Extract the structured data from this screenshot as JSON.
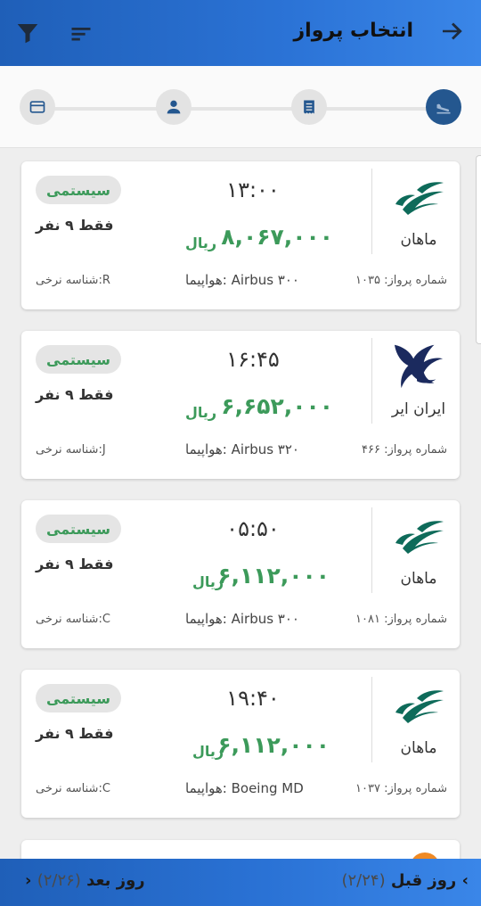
{
  "header": {
    "title": "انتخاب پرواز"
  },
  "icons": {
    "back": "arrow-right-icon",
    "filter": "filter-icon",
    "sort": "sort-icon"
  },
  "stepper": {
    "steps": [
      "flight-step",
      "invoice-step",
      "passenger-step",
      "payment-step"
    ],
    "active_index": 0,
    "colors": {
      "active": "#24578f",
      "inactive": "#e3e3e3"
    }
  },
  "flights": [
    {
      "airline": "ماهان",
      "time": "۱۳:۰۰",
      "price": "۸,۰۶۷,۰۰۰",
      "currency": "ریال",
      "badge": "سیستمی",
      "seats": "فقط ۹ نفر",
      "flight_no": "شماره پرواز: ۱۰۳۵",
      "aircraft": "هواپیما: Airbus ۳۰۰",
      "fare": "شناسه نرخی:R"
    },
    {
      "airline": "ایران ایر",
      "time": "۱۶:۴۵",
      "price": "۶,۶۵۲,۰۰۰",
      "currency": "ریال",
      "badge": "سیستمی",
      "seats": "فقط ۹ نفر",
      "flight_no": "شماره پرواز: ۴۶۶",
      "aircraft": "هواپیما: Airbus ۳۲۰",
      "fare": "شناسه نرخی:J"
    },
    {
      "airline": "ماهان",
      "time": "۰۵:۵۰",
      "price": "۶,۱۱۲,۰۰۰",
      "currency": "ریال",
      "badge": "سیستمی",
      "seats": "فقط ۹ نفر",
      "flight_no": "شماره پرواز: ۱۰۸۱",
      "aircraft": "هواپیما: Airbus ۳۰۰",
      "fare": "شناسه نرخی:C"
    },
    {
      "airline": "ماهان",
      "time": "۱۹:۴۰",
      "price": "۶,۱۱۲,۰۰۰",
      "currency": "ریال",
      "badge": "سیستمی",
      "seats": "فقط ۹ نفر",
      "flight_no": "شماره پرواز: ۱۰۳۷",
      "aircraft": "هواپیما: Boeing MD",
      "fare": "شناسه نرخی:C"
    }
  ],
  "footer": {
    "prev_label": "روز قبل",
    "prev_count": "(۲/۲۴)",
    "next_label": "روز بعد",
    "next_count": "(۲/۲۶)"
  },
  "colors": {
    "header": "#2b73d6",
    "price": "#3c9a5a",
    "badge_bg": "#e5e5e5"
  }
}
